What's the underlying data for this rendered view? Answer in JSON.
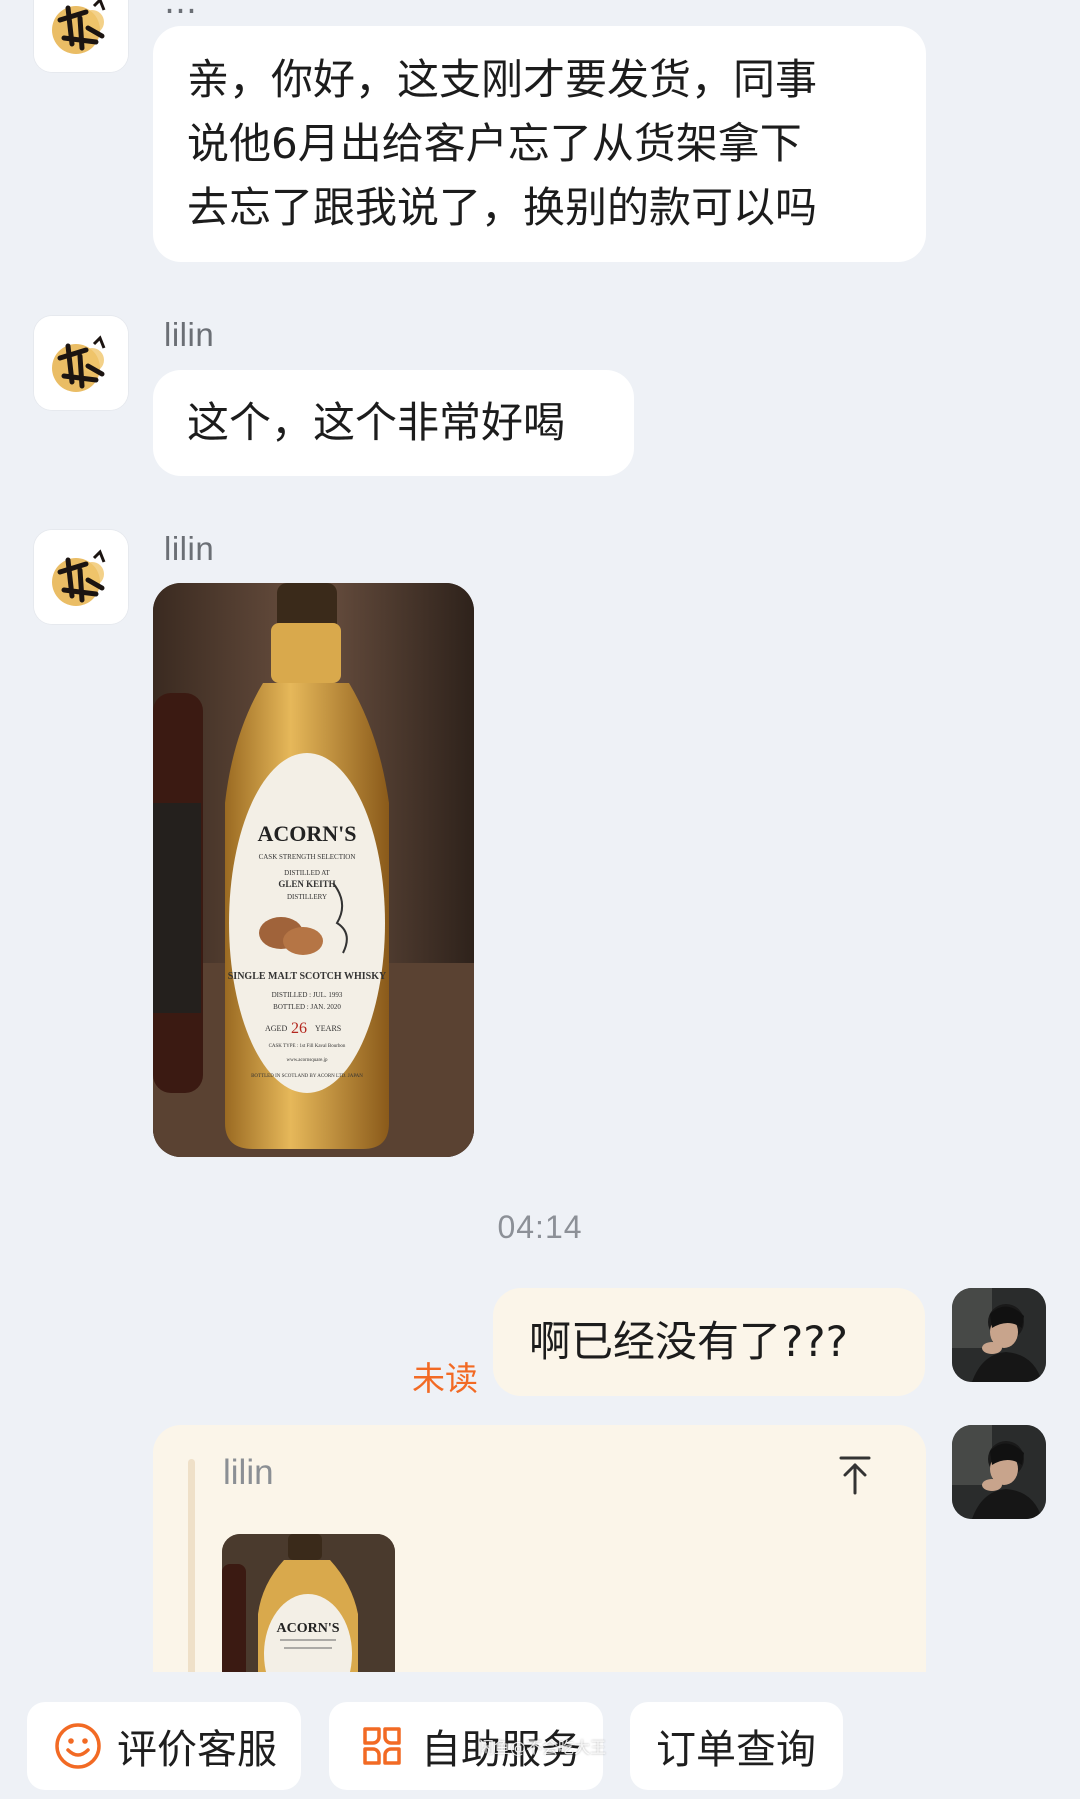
{
  "messages": [
    {
      "sender": "lilin",
      "lines": [
        "亲，你好，这支刚才要发货，同事",
        "说他6月出给客户忘了从货架拿下",
        "去忘了跟我说了，换别的款可以吗"
      ]
    },
    {
      "sender": "lilin",
      "text": "这个，这个非常好喝"
    },
    {
      "sender": "lilin",
      "image": {
        "label_brand": "ACORN'S",
        "label_line1": "CASK STRENGTH SELECTION",
        "label_line2": "DISTILLED AT",
        "label_line3": "GLEN KEITH",
        "label_line4": "DISTILLERY",
        "label_line5": "SINGLE MALT SCOTCH WHISKY",
        "label_line6": "DISTILLED : JUL. 1993",
        "label_line7": "BOTTLED : JAN. 2020",
        "label_aged": "AGED",
        "label_years_num": "26",
        "label_years": "YEARS",
        "label_cask": "CASK TYPE : 1st Fill Kaval Bourbon",
        "label_url": "www.acornsquare.jp",
        "label_bottom": "BOTTLED IN SCOTLAND BY ACORN LTD. JAPAN"
      }
    }
  ],
  "timestamp": "04:14",
  "my_message": {
    "text": "啊已经没有了???",
    "status": "未读"
  },
  "quote": {
    "name": "lilin",
    "thumb_brand": "ACORN'S"
  },
  "quick_actions": [
    {
      "label": "评价客服",
      "icon": "smile-icon"
    },
    {
      "label": "自助服务",
      "icon": "grid-flower-icon"
    },
    {
      "label": "订单查询",
      "icon": ""
    }
  ],
  "watermark": "闲鱼@不会吃大王",
  "colors": {
    "background": "#eef1f6",
    "bubble_left": "#ffffff",
    "bubble_right": "#fbf5e9",
    "unread": "#f26a24",
    "accent_orange": "#f26a24"
  }
}
